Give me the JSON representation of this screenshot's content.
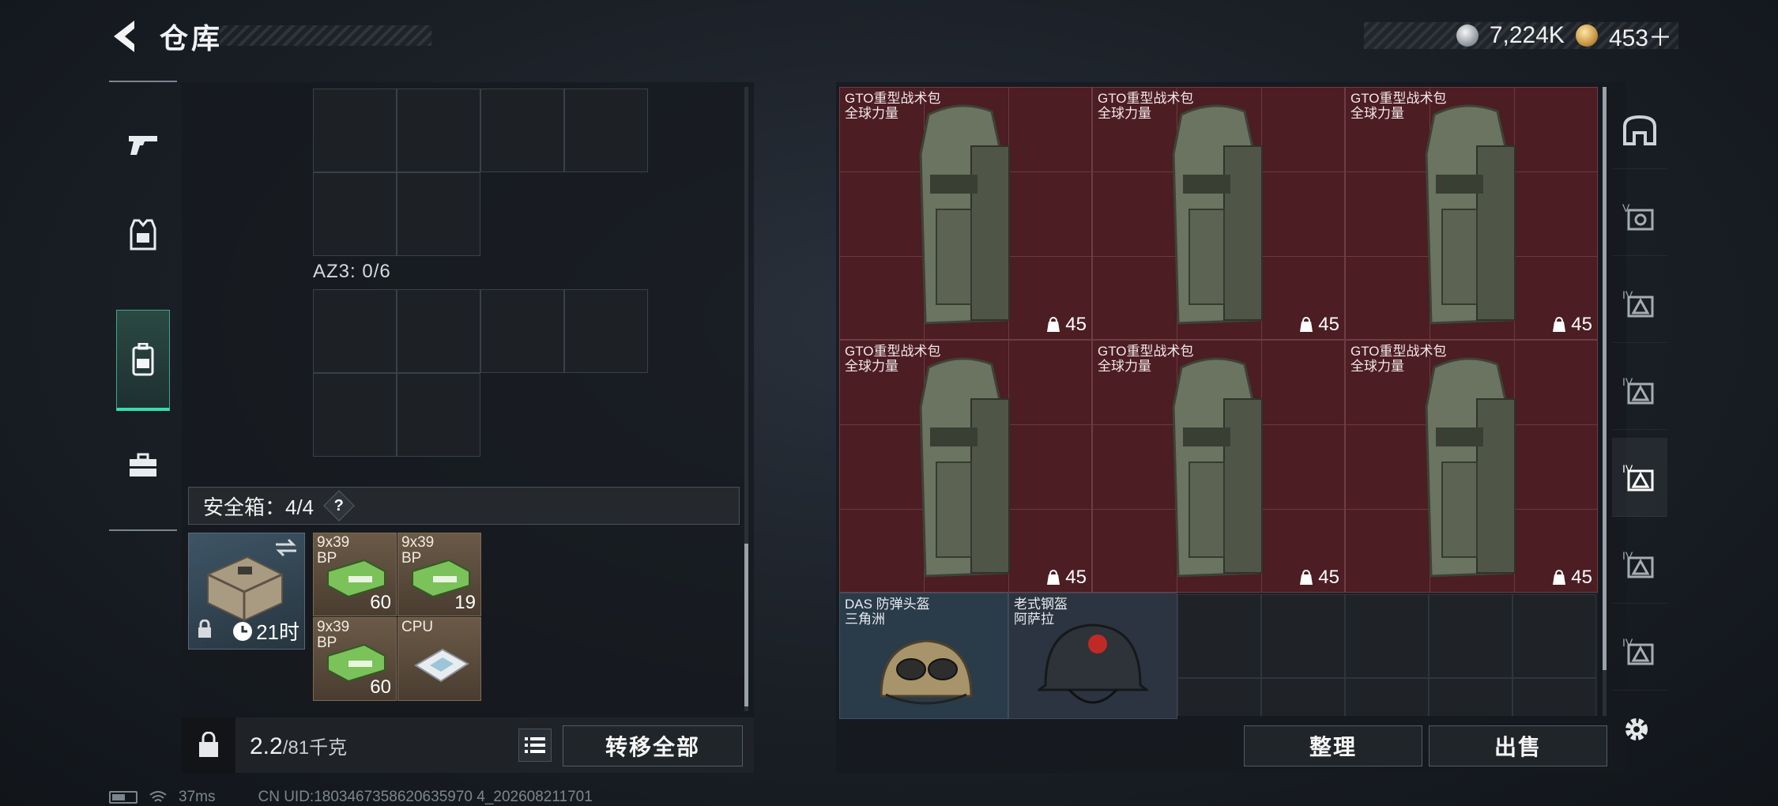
{
  "header": {
    "title": "仓库",
    "silver_amount": "7,224K",
    "gold_amount": "453＋"
  },
  "left_nav": {
    "items": [
      "pistol-icon",
      "armor-vest-icon",
      "backpack-icon",
      "briefcase-icon"
    ],
    "active": "backpack-icon"
  },
  "loadout": {
    "az3_label": "AZ3: 0/6",
    "safebox_label": "安全箱：4/4",
    "help_symbol": "?",
    "case_timer": "21时",
    "safe_items": [
      {
        "name": "9x39\nBP",
        "count": "60"
      },
      {
        "name": "9x39\nBP",
        "count": "19"
      },
      {
        "name": "9x39\nBP",
        "count": "60"
      },
      {
        "name": "CPU",
        "count": ""
      }
    ],
    "weight": "2.2",
    "weight_cap": "/81千克",
    "transfer_all": "转移全部"
  },
  "stash": {
    "bags": [
      {
        "name": "GTO重型战术包\n全球力量",
        "capacity": "45"
      },
      {
        "name": "GTO重型战术包\n全球力量",
        "capacity": "45"
      },
      {
        "name": "GTO重型战术包\n全球力量",
        "capacity": "45"
      },
      {
        "name": "GTO重型战术包\n全球力量",
        "capacity": "45"
      },
      {
        "name": "GTO重型战术包\n全球力量",
        "capacity": "45"
      },
      {
        "name": "GTO重型战术包\n全球力量",
        "capacity": "45"
      }
    ],
    "helmets": [
      {
        "name": "DAS 防弹头盔\n三角洲"
      },
      {
        "name": "老式钢盔\n阿萨拉"
      }
    ],
    "sort_label": "整理",
    "sell_label": "出售"
  },
  "right_tabs": [
    "home-icon",
    "v-armor-icon",
    "iv-armor-icon",
    "iv-armor-icon",
    "iv-armor-icon",
    "iv-armor-icon",
    "iv-armor-icon"
  ],
  "status": {
    "ping": "37ms",
    "uid": "CN UID:1803467358620635970 4_202608211701"
  },
  "colors": {
    "accent_green": "#34e0a9",
    "bag_red": "#4c1d23",
    "safe_brown": "#6b5a47"
  }
}
